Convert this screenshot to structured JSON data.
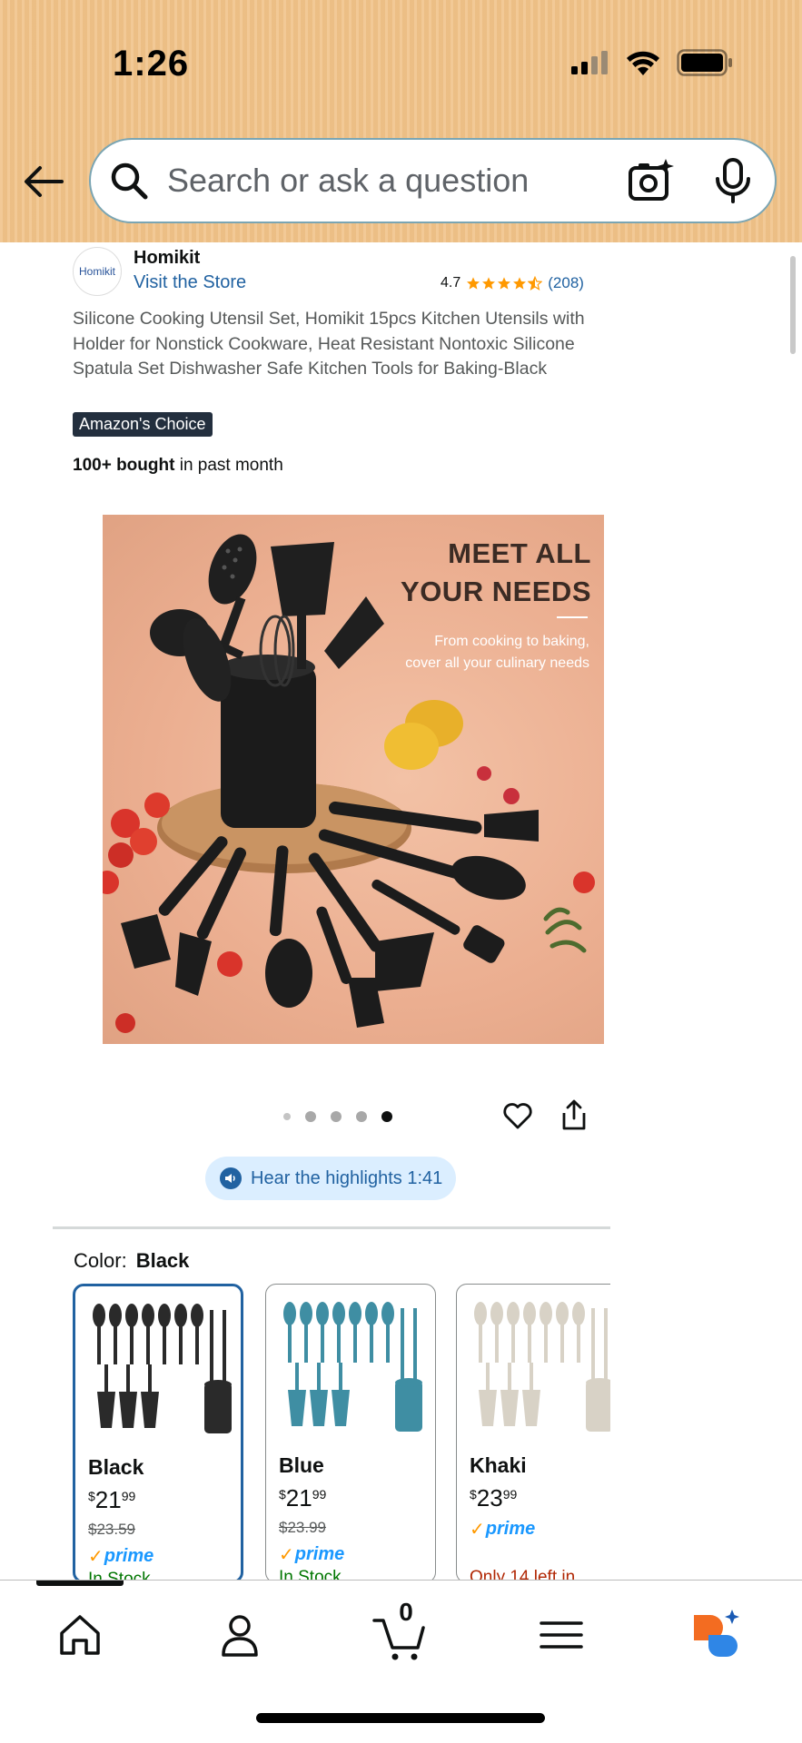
{
  "status_bar": {
    "time": "1:26"
  },
  "search": {
    "placeholder": "Search or ask a question"
  },
  "store": {
    "logo_text": "Homikit",
    "name": "Homikit",
    "visit_label": "Visit the Store"
  },
  "rating": {
    "value": "4.7",
    "stars": 4.7,
    "count": "(208)"
  },
  "product": {
    "title": "Silicone Cooking Utensil Set, Homikit 15pcs Kitchen Utensils with Holder for Nonstick Cookware, Heat Resistant Nontoxic Silicone Spatula Set Dishwasher Safe Kitchen Tools for Baking-Black",
    "badge": "Amazon's Choice",
    "bought_bold": "100+ bought",
    "bought_rest": " in past month"
  },
  "image": {
    "headline_line1": "MEET ALL",
    "headline_line2": "YOUR NEEDS",
    "sub_line1": "From cooking to baking,",
    "sub_line2": "cover all your culinary needs"
  },
  "carousel": {
    "total": 5,
    "active_index": 4
  },
  "highlights": {
    "label": "Hear the highlights 1:41"
  },
  "color_selector": {
    "label": "Color:",
    "selected": "Black",
    "options": [
      {
        "name": "Black",
        "currency": "$",
        "whole": "21",
        "cents": "99",
        "list_price": "$23.59",
        "prime": "prime",
        "stock": "In Stock",
        "color": "#2a2a2a"
      },
      {
        "name": "Blue",
        "currency": "$",
        "whole": "21",
        "cents": "99",
        "list_price": "$23.99",
        "prime": "prime",
        "stock": "In Stock",
        "color": "#3f8ea3"
      },
      {
        "name": "Khaki",
        "currency": "$",
        "whole": "23",
        "cents": "99",
        "list_price": "",
        "prime": "prime",
        "stock": "Only 14 left in",
        "color": "#d8d2c6"
      }
    ]
  },
  "bottom_nav": {
    "items": [
      "home-icon",
      "account-icon",
      "cart-icon",
      "menu-icon",
      "rufus-icon"
    ],
    "cart_count": "0"
  },
  "colors": {
    "header": "#f0c38a",
    "link": "#2162a1",
    "star": "#ff9900",
    "prime": "#1a98ff",
    "in_stock": "#007600",
    "low_stock": "#b12704",
    "badge_bg": "#232f3e"
  }
}
